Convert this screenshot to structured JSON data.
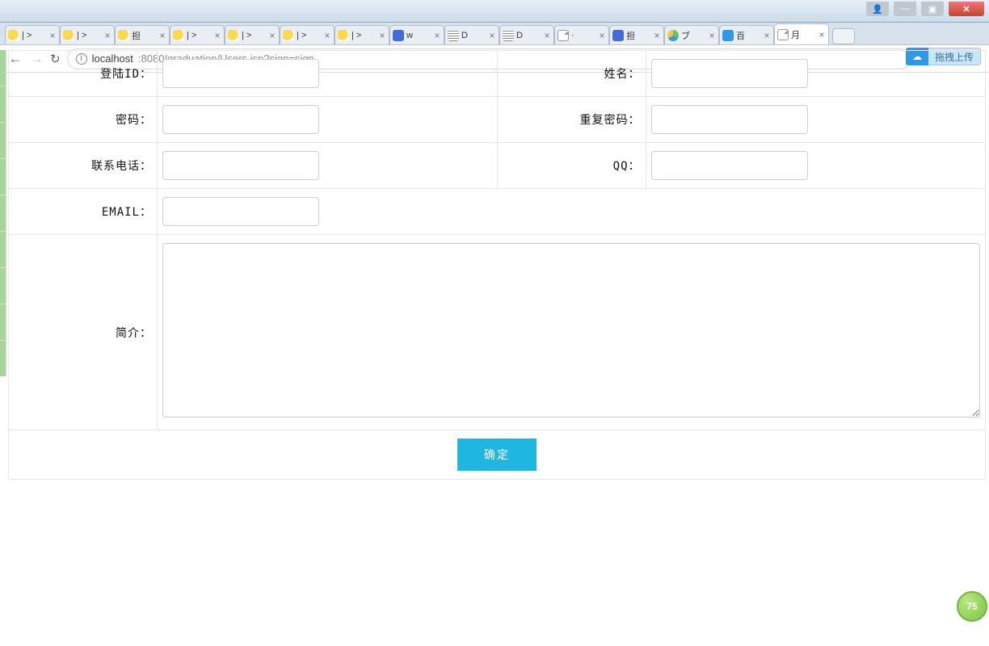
{
  "window": {
    "close_glyph": "✕",
    "min_glyph": "—",
    "max_glyph": "▣",
    "user_glyph": "👤"
  },
  "tabs": [
    {
      "title": "| >",
      "favi": "sun"
    },
    {
      "title": "| >",
      "favi": "sun"
    },
    {
      "title": "担",
      "favi": "sun"
    },
    {
      "title": "| >",
      "favi": "sun"
    },
    {
      "title": "| >",
      "favi": "sun"
    },
    {
      "title": "| >",
      "favi": "sun"
    },
    {
      "title": "| >",
      "favi": "sun"
    },
    {
      "title": "w",
      "favi": "baidu"
    },
    {
      "title": "D",
      "favi": "grid"
    },
    {
      "title": "D",
      "favi": "grid"
    },
    {
      "title": "·",
      "favi": "page"
    },
    {
      "title": "担",
      "favi": "baidu"
    },
    {
      "title": "ブ",
      "favi": "tx"
    },
    {
      "title": "百",
      "favi": "cloud"
    },
    {
      "title": "月",
      "favi": "page",
      "active": true
    }
  ],
  "address": {
    "back": "←",
    "fwd": "→",
    "reload": "↻",
    "info_glyph": "i",
    "host": "localhost",
    "rest": ":8080/graduation/Users.jsp?sign=sign",
    "key_glyph": "🔑",
    "star_glyph": "☆",
    "menu_glyph": "⋮"
  },
  "drag_upload": {
    "icon": "☁",
    "text": "拖拽上传"
  },
  "form": {
    "login_id": {
      "label": "登陆ID：",
      "value": ""
    },
    "name": {
      "label": "姓名：",
      "value": ""
    },
    "password": {
      "label": "密码：",
      "value": ""
    },
    "password2": {
      "label": "重复密码：",
      "value": ""
    },
    "phone": {
      "label": "联系电话：",
      "value": ""
    },
    "qq": {
      "label": "QQ：",
      "value": ""
    },
    "email": {
      "label": "EMAIL：",
      "value": ""
    },
    "intro": {
      "label": "简介：",
      "value": ""
    },
    "submit": "确定"
  },
  "badge": "75"
}
